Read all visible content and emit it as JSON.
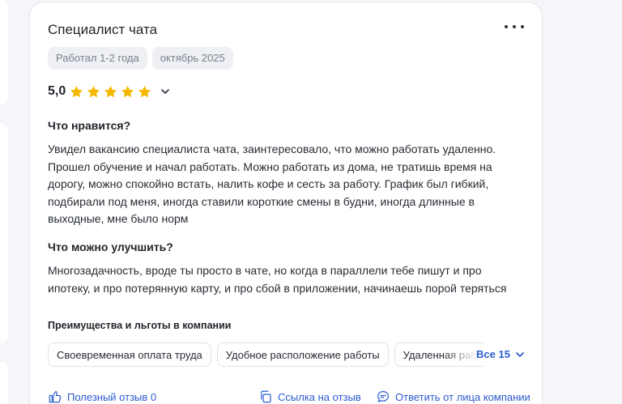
{
  "review": {
    "title": "Специалист чата",
    "tags": [
      "Работал 1-2 года",
      "октябрь 2025"
    ],
    "rating": "5,0",
    "stars_filled": 5,
    "stars_total": 5,
    "likes_heading": "Что нравится?",
    "likes_text": "Увидел вакансию специалиста чата, заинтересовало, что можно работать удаленно. Прошел обучение и начал работать. Можно работать из дома, не тратишь время на дорогу, можно спокойно встать, налить кофе и сесть за работу. График был гибкий, подбирали под меня, иногда ставили короткие смены в будни, иногда длинные в выходные, мне было норм",
    "improve_heading": "Что можно улучшить?",
    "improve_text": "Многозадачность, вроде ты просто в чате, но когда в параллели тебе пишут и про ипотеку, и про потерянную карту, и про сбой в приложении, начинаешь порой теряться",
    "benefits_title": "Преимущества и льготы в компании",
    "benefits": [
      "Своевременная оплата труда",
      "Удобное расположение работы",
      "Удаленная работа"
    ],
    "benefits_all": "Все 15"
  },
  "footer": {
    "helpful": "Полезный отзыв 0",
    "link": "Ссылка на отзыв",
    "reply": "Ответить от лица компании"
  },
  "colors": {
    "accent": "#2c5bd1",
    "star": "#f5b800",
    "tag_bg": "#eef0f4"
  }
}
